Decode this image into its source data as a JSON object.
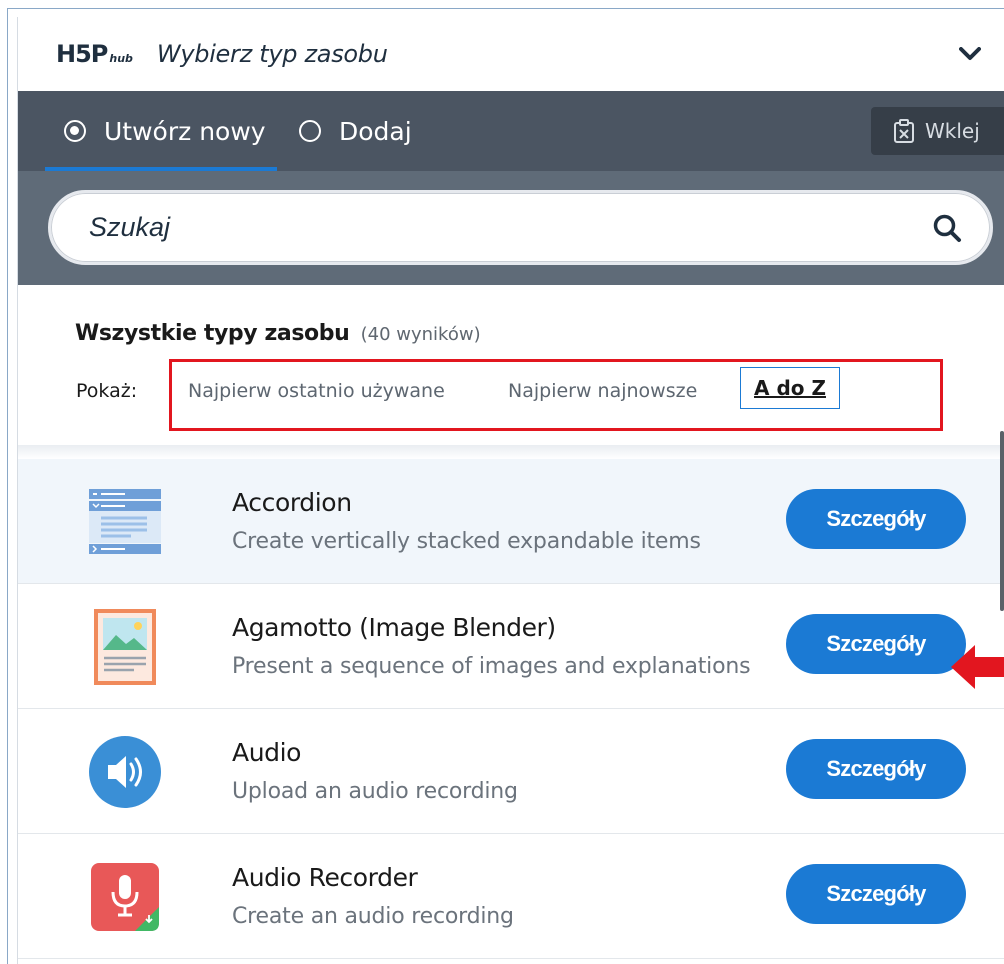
{
  "header": {
    "logo_main": "H5P",
    "logo_sub": "hub",
    "title": "Wybierz typ zasobu"
  },
  "tabs": [
    {
      "label": "Utwórz nowy",
      "selected": true
    },
    {
      "label": "Dodaj",
      "selected": false
    }
  ],
  "paste": {
    "label": "Wklej"
  },
  "search": {
    "placeholder": "Szukaj"
  },
  "results": {
    "title": "Wszystkie typy zasobu",
    "count": "(40 wyników)",
    "show_label": "Pokaż:",
    "sort_options": [
      "Najpierw ostatnio używane",
      "Najpierw najnowsze",
      "A do Z"
    ],
    "active_sort": "A do Z"
  },
  "items": [
    {
      "title": "Accordion",
      "description": "Create vertically stacked expandable items",
      "icon": "accordion-icon",
      "button": "Szczegóły"
    },
    {
      "title": "Agamotto (Image Blender)",
      "description": "Present a sequence of images and explanations",
      "icon": "image-blender-icon",
      "button": "Szczegóły"
    },
    {
      "title": "Audio",
      "description": "Upload an audio recording",
      "icon": "speaker-icon",
      "button": "Szczegóły"
    },
    {
      "title": "Audio Recorder",
      "description": "Create an audio recording",
      "icon": "microphone-icon",
      "button": "Szczegóły"
    }
  ],
  "colors": {
    "accent": "#1b7ad4",
    "tab_bar": "#4b5562",
    "search_bg": "#5f6b78",
    "annotation": "#e2161f"
  }
}
